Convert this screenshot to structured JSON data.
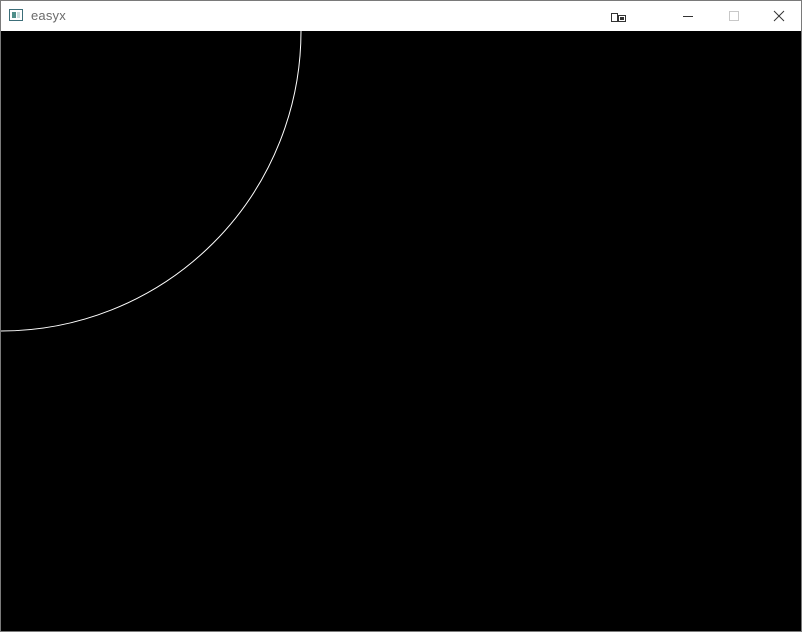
{
  "window": {
    "title": "easyx"
  },
  "titlebar": {
    "icons": {
      "app": "app-window-icon",
      "ime": "input-method-icon",
      "minimize": "minimize-icon",
      "maximize": "maximize-icon",
      "close": "close-icon"
    }
  },
  "canvas": {
    "background": "#000000",
    "shape": "circle-outline",
    "stroke_color": "#ffffff"
  }
}
